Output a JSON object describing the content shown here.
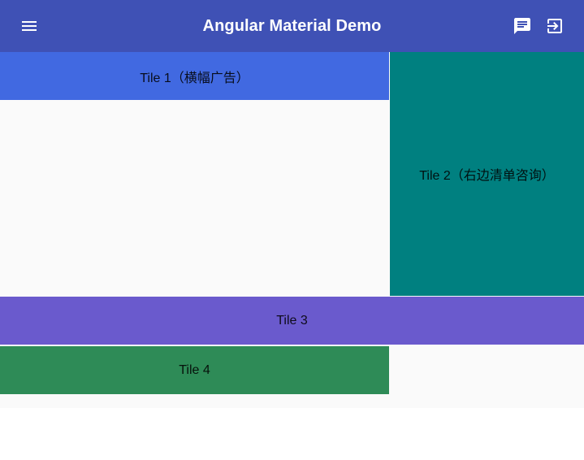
{
  "toolbar": {
    "title": "Angular Material Demo",
    "background": "#3f51b5",
    "menu_icon": "menu-icon",
    "actions": [
      {
        "icon": "chat-icon"
      },
      {
        "icon": "logout-icon"
      }
    ]
  },
  "grid": {
    "background": "#fafafa",
    "tiles": [
      {
        "label": "Tile 1（横幅广告）",
        "color": "#4169e1"
      },
      {
        "label": "Tile 2（右边清单咨询）",
        "color": "#008080"
      },
      {
        "label": "Tile 3",
        "color": "#6a5acd"
      },
      {
        "label": "Tile 4",
        "color": "#2e8b57"
      }
    ]
  }
}
